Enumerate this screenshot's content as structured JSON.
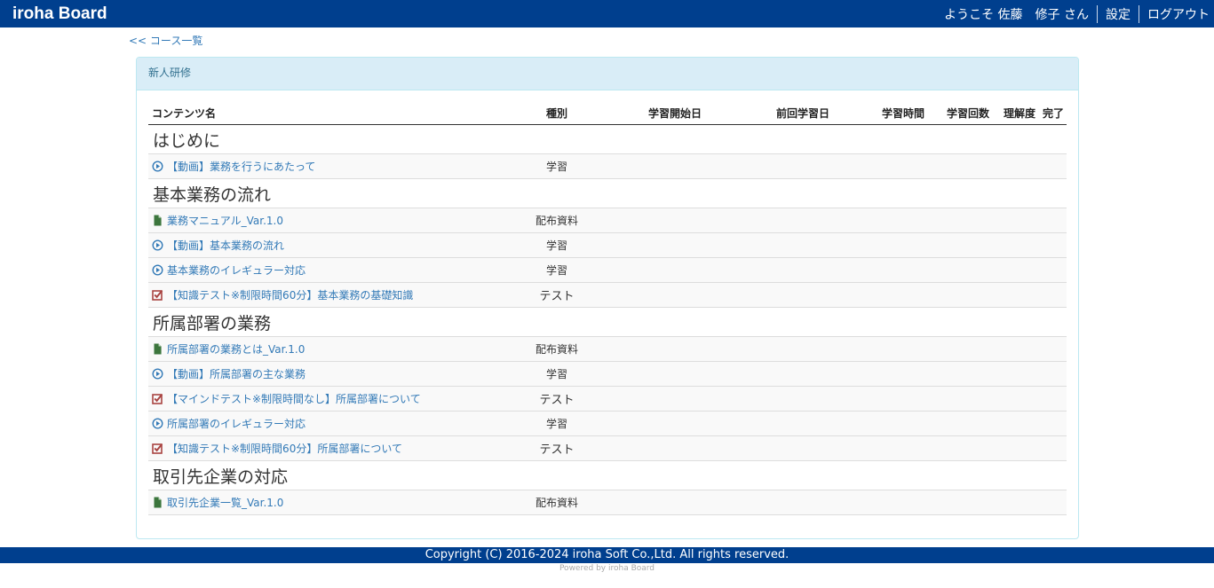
{
  "header": {
    "brand": "iroha Board",
    "welcome": "ようこそ 佐藤　修子 さん",
    "settings": "設定",
    "logout": "ログアウト"
  },
  "back_link": "<< コース一覧",
  "course": {
    "title": "新人研修",
    "columns": {
      "name": "コンテンツ名",
      "kind": "種別",
      "start": "学習開始日",
      "last": "前回学習日",
      "time": "学習時間",
      "count": "学習回数",
      "understanding": "理解度",
      "done": "完了"
    },
    "groups": [
      {
        "title": "はじめに",
        "items": [
          {
            "icon": "play-circle-icon",
            "name": "【動画】業務を行うにあたって",
            "kind": "学習"
          }
        ]
      },
      {
        "title": "基本業務の流れ",
        "items": [
          {
            "icon": "file-icon",
            "name": "業務マニュアル_Var.1.0",
            "kind": "配布資料"
          },
          {
            "icon": "play-circle-icon",
            "name": "【動画】基本業務の流れ",
            "kind": "学習"
          },
          {
            "icon": "play-circle-icon",
            "name": "基本業務のイレギュラー対応",
            "kind": "学習"
          },
          {
            "icon": "check-square-icon",
            "name": "【知識テスト※制限時間60分】基本業務の基礎知識",
            "kind": "テスト"
          }
        ]
      },
      {
        "title": "所属部署の業務",
        "items": [
          {
            "icon": "file-icon",
            "name": "所属部署の業務とは_Var.1.0",
            "kind": "配布資料"
          },
          {
            "icon": "play-circle-icon",
            "name": "【動画】所属部署の主な業務",
            "kind": "学習"
          },
          {
            "icon": "check-square-icon",
            "name": "【マインドテスト※制限時間なし】所属部署について",
            "kind": "テスト"
          },
          {
            "icon": "play-circle-icon",
            "name": "所属部署のイレギュラー対応",
            "kind": "学習"
          },
          {
            "icon": "check-square-icon",
            "name": "【知識テスト※制限時間60分】所属部署について",
            "kind": "テスト"
          }
        ]
      },
      {
        "title": "取引先企業の対応",
        "items": [
          {
            "icon": "file-icon",
            "name": "取引先企業一覧_Var.1.0",
            "kind": "配布資料"
          }
        ]
      }
    ]
  },
  "footer": {
    "copyright": "Copyright (C) 2016-2024 iroha Soft Co.,Ltd. All rights reserved.",
    "powered": "Powered by iroha Board"
  },
  "colors": {
    "header_bg": "#003f8e",
    "link": "#337ab7",
    "panel_heading_bg": "#d9edf7",
    "file_icon": "#3c763d",
    "test_icon": "#a94442"
  }
}
